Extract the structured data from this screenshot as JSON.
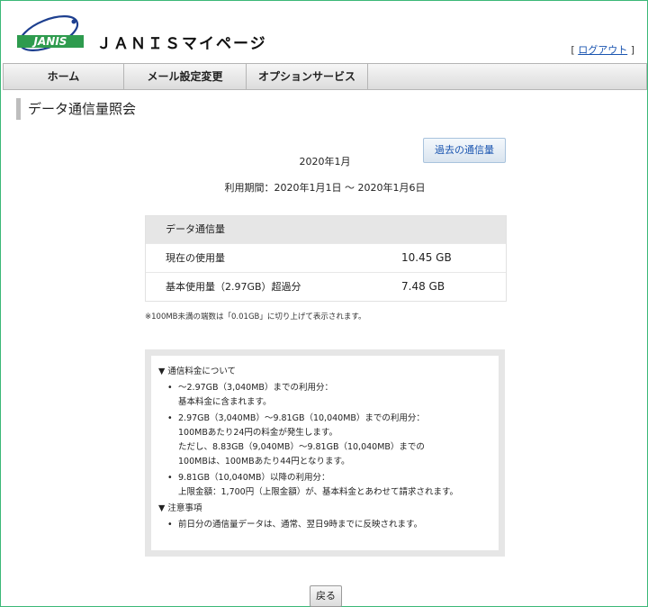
{
  "header": {
    "brand_text": "JANIS",
    "site_title": "ＪＡＮＩＳマイページ",
    "logout_open": "[",
    "logout_label": "ログアウト",
    "logout_close": "]"
  },
  "nav": {
    "items": [
      {
        "label": "ホーム"
      },
      {
        "label": "メール設定変更"
      },
      {
        "label": "オプションサービス"
      }
    ]
  },
  "page": {
    "title": "データ通信量照会",
    "history_button": "過去の通信量",
    "month": "2020年1月",
    "period": "利用期間：2020年1月1日 ～ 2020年1月6日"
  },
  "usage": {
    "header": "データ通信量",
    "rows": [
      {
        "label": "現在の使用量",
        "value": "10.45 GB"
      },
      {
        "label": "基本使用量（2.97GB）超過分",
        "value": "7.48 GB"
      }
    ],
    "note": "※100MB未満の端数は「0.01GB」に切り上げて表示されます。"
  },
  "info": {
    "fees_title": "▼ 通信料金について",
    "fees": [
      {
        "lines": [
          "～2.97GB（3,040MB）までの利用分：",
          "基本料金に含まれます。"
        ]
      },
      {
        "lines": [
          "2.97GB（3,040MB）～9.81GB（10,040MB）までの利用分：",
          "100MBあたり24円の料金が発生します。",
          "ただし、8.83GB（9,040MB）～9.81GB（10,040MB）までの",
          "100MBは、100MBあたり44円となります。"
        ]
      },
      {
        "lines": [
          "9.81GB（10,040MB）以降の利用分：",
          "上限金額：1,700円（上限金額）が、基本料金とあわせて請求されます。"
        ]
      }
    ],
    "notes_title": "▼ 注意事項",
    "notes": [
      {
        "lines": [
          "前日分の通信量データは、通常、翌日9時までに反映されます。"
        ]
      }
    ]
  },
  "back_button": "戻る",
  "colors": {
    "frame_border": "#3cb878",
    "logo_green": "#2e9b4e",
    "logo_blue": "#1d3f8f",
    "link_blue": "#1a55b0"
  }
}
